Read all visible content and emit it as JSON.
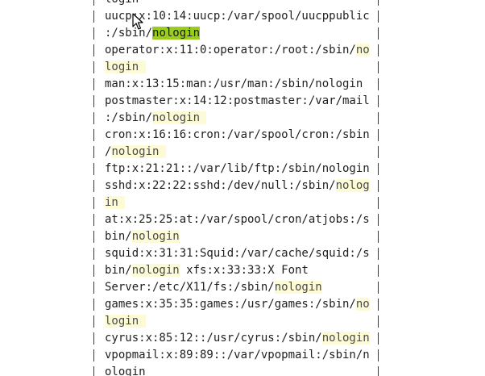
{
  "search": {
    "term": "nologin"
  },
  "lines": [
    {
      "parts": [
        {
          "t": "login",
          "h": false
        }
      ]
    },
    {
      "parts": [
        {
          "t": "uucp:x:10:14:uucp:/var/spool/uucppublic",
          "h": false
        }
      ]
    },
    {
      "parts": [
        {
          "t": ":/sbin/",
          "h": false
        },
        {
          "t": "nologin",
          "h": "current"
        }
      ]
    },
    {
      "parts": [
        {
          "t": "operator:x:11:0:operator:/root:/sbin/",
          "h": false
        },
        {
          "t": "no",
          "h": true
        }
      ]
    },
    {
      "parts": [
        {
          "t": "login ",
          "h": true
        }
      ]
    },
    {
      "parts": [
        {
          "t": "man:x:13:15:man:/usr/man:/sbin/nologin",
          "h": false
        }
      ]
    },
    {
      "parts": [
        {
          "t": "postmaster:x:14:12:postmaster:/var/mail",
          "h": false
        }
      ]
    },
    {
      "parts": [
        {
          "t": ":/sbin/",
          "h": false
        },
        {
          "t": "nologin ",
          "h": true
        }
      ]
    },
    {
      "parts": [
        {
          "t": "cron:x:16:16:cron:/var/spool/cron:/sbin",
          "h": false
        }
      ]
    },
    {
      "parts": [
        {
          "t": "/",
          "h": false
        },
        {
          "t": "nologin ",
          "h": true
        }
      ]
    },
    {
      "parts": [
        {
          "t": "ftp:x:21:21::/var/lib/ftp:/sbin/nologin",
          "h": false
        }
      ]
    },
    {
      "parts": [
        {
          "t": "sshd:x:22:22:sshd:/dev/null:/sbin/",
          "h": false
        },
        {
          "t": "nolog",
          "h": true
        }
      ]
    },
    {
      "parts": [
        {
          "t": "in ",
          "h": true
        }
      ]
    },
    {
      "parts": [
        {
          "t": "at:x:25:25:at:/var/spool/cron/atjobs:/s",
          "h": false
        }
      ]
    },
    {
      "parts": [
        {
          "t": "bin/",
          "h": false
        },
        {
          "t": "nologin",
          "h": true
        }
      ]
    },
    {
      "parts": [
        {
          "t": "squid:x:31:31:Squid:/var/cache/squid:/s",
          "h": false
        }
      ]
    },
    {
      "parts": [
        {
          "t": "bin/",
          "h": false
        },
        {
          "t": "nologin",
          "h": true
        },
        {
          "t": " xfs:x:33:33:X Font",
          "h": false
        }
      ]
    },
    {
      "parts": [
        {
          "t": "Server:/etc/X11/fs:/sbin/",
          "h": false
        },
        {
          "t": "nologin",
          "h": true
        }
      ]
    },
    {
      "parts": [
        {
          "t": "games:x:35:35:games:/usr/games:/sbin/",
          "h": false
        },
        {
          "t": "no",
          "h": true
        }
      ]
    },
    {
      "parts": [
        {
          "t": "login ",
          "h": true
        }
      ]
    },
    {
      "parts": [
        {
          "t": "cyrus:x:85:12::/usr/cyrus:/sbin/",
          "h": false
        },
        {
          "t": "nologin",
          "h": true
        }
      ]
    },
    {
      "parts": [
        {
          "t": "vpopmail:x:89:89::/var/vpopmail:/sbin/n",
          "h": false
        }
      ]
    },
    {
      "parts": [
        {
          "t": "ologin",
          "h": false
        }
      ]
    }
  ]
}
